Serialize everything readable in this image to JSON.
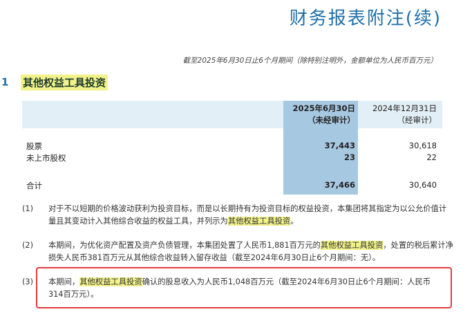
{
  "title": "财务报表附注(续)",
  "subtitle": "截至2025年6月30日止6个月期间（除特别注明外，金额单位为人民币百万元）",
  "section": {
    "number": "1",
    "heading": "其他权益工具投资"
  },
  "table": {
    "col1_line1": "2025年6月30日",
    "col1_line2": "（未经审计）",
    "col2_line1": "2024年12月31日",
    "col2_line2": "（经审计）",
    "rows": [
      {
        "label": "股票",
        "v1": "37,443",
        "v2": "30,618"
      },
      {
        "label": "未上市股权",
        "v1": "23",
        "v2": "22"
      }
    ],
    "total": {
      "label": "合计",
      "v1": "37,466",
      "v2": "30,640"
    }
  },
  "notes": [
    {
      "num": "(1)",
      "pre": "对于不以短期的价格波动获利为投资目标，而是以长期持有为投资目标的权益投资，本集团将其指定为以公允价值计量且其变动计入其他综合收益的权益工具，并列示为",
      "hl": "其他权益工具投资",
      "post": "。"
    },
    {
      "num": "(2)",
      "pre": "本期间，为优化资产配置及资产负债管理，本集团处置了人民币1,881百万元的",
      "hl": "其他权益工具投资",
      "post": "，处置的税后累计净损失人民币381百万元从其他综合收益转入留存收益（截至2024年6月30日止6个月期间：无）。"
    },
    {
      "num": "(3)",
      "pre": "本期间，",
      "hl": "其他权益工具投资",
      "post": "确认的股息收入为人民币1,048百万元（截至2024年6月30日止6个月期间：人民币314百万元）。"
    }
  ],
  "colors": {
    "title": "#1f6fa8",
    "highlight": "#f2f28a",
    "header_band": "#e3eff6",
    "current_column": "#a7c8e1",
    "annotation_box": "#e23a3a"
  }
}
